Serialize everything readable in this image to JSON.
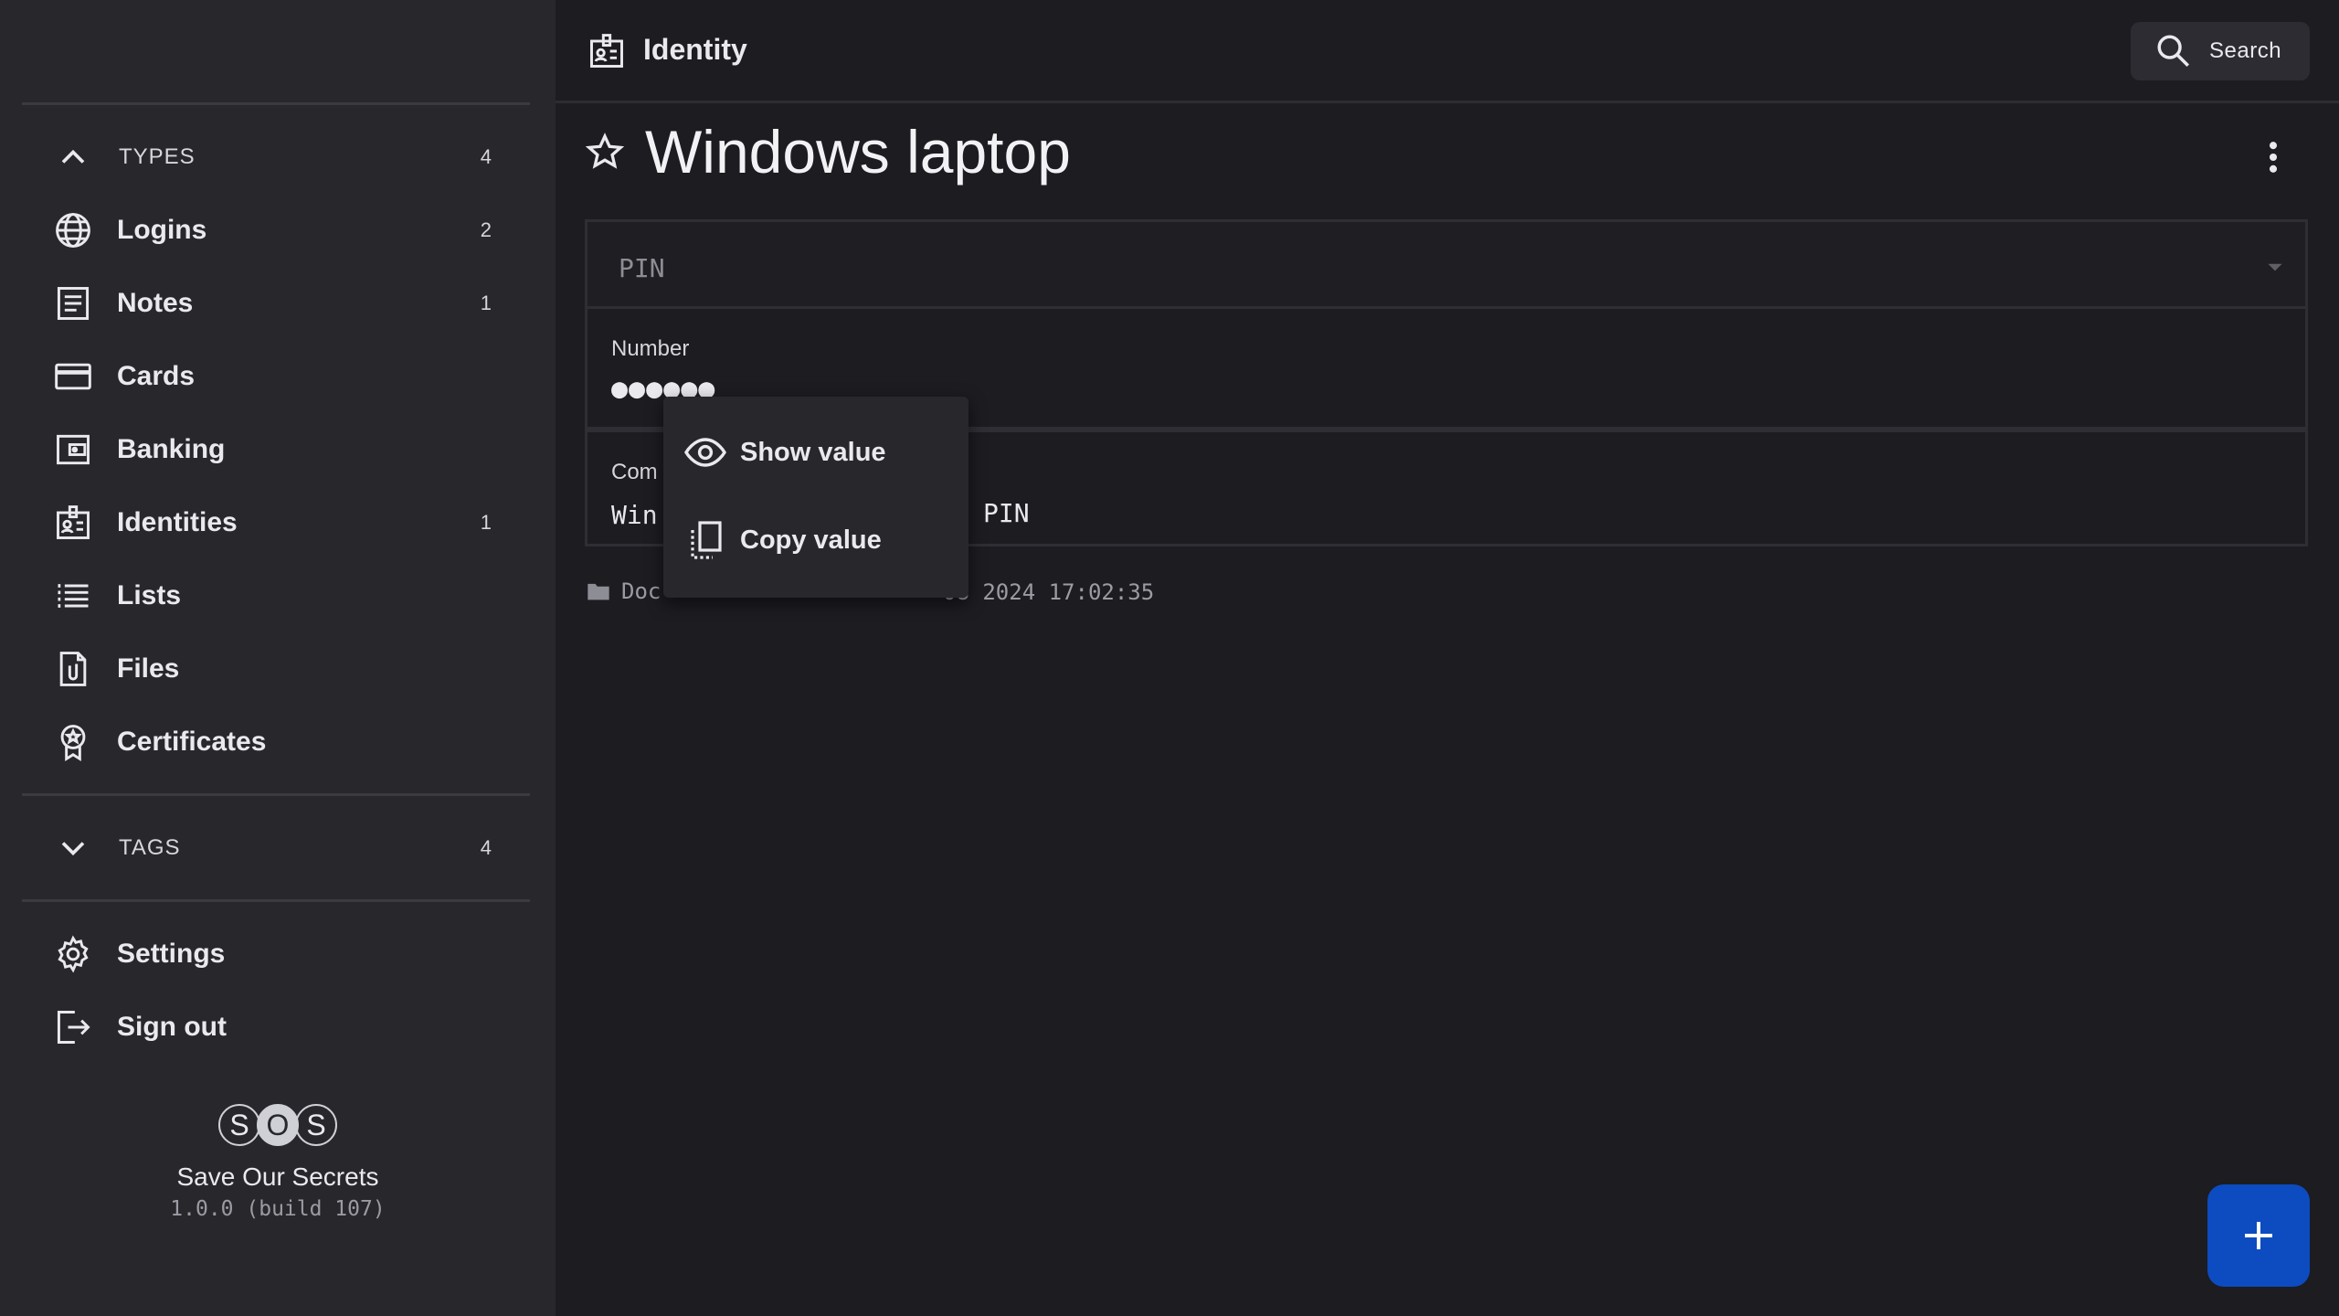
{
  "sidebar": {
    "types_section": {
      "label": "TYPES",
      "count": "4"
    },
    "items": [
      {
        "label": "Logins",
        "count": "2",
        "icon": "globe-icon"
      },
      {
        "label": "Notes",
        "count": "1",
        "icon": "note-icon"
      },
      {
        "label": "Cards",
        "count": "",
        "icon": "credit-card-icon"
      },
      {
        "label": "Banking",
        "count": "",
        "icon": "wallet-icon"
      },
      {
        "label": "Identities",
        "count": "1",
        "icon": "id-card-icon"
      },
      {
        "label": "Lists",
        "count": "",
        "icon": "list-icon"
      },
      {
        "label": "Files",
        "count": "",
        "icon": "file-icon"
      },
      {
        "label": "Certificates",
        "count": "",
        "icon": "certificate-icon"
      }
    ],
    "tags_section": {
      "label": "TAGS",
      "count": "4"
    },
    "settings_label": "Settings",
    "signout_label": "Sign out",
    "brand": {
      "logo_letters": [
        "S",
        "O",
        "S"
      ],
      "app_name": "Save Our Secrets",
      "version": "1.0.0 (build 107)"
    }
  },
  "header": {
    "title": "Identity",
    "search_label": "Search"
  },
  "record": {
    "title": "Windows laptop",
    "kind_select": "PIN",
    "number_label": "Number",
    "number_value": "●●●●●●",
    "comment_label_visible": "Com",
    "comment_value_visible": "Win",
    "comment_value_tail": "PIN",
    "folder_visible": "Doc",
    "timestamp_visible": "08 2024 17:02:35"
  },
  "context_menu": {
    "show_label": "Show value",
    "copy_label": "Copy value"
  },
  "colors": {
    "background": "#1c1c21",
    "sidebar": "#27272c",
    "accent": "#0d4bc0"
  }
}
